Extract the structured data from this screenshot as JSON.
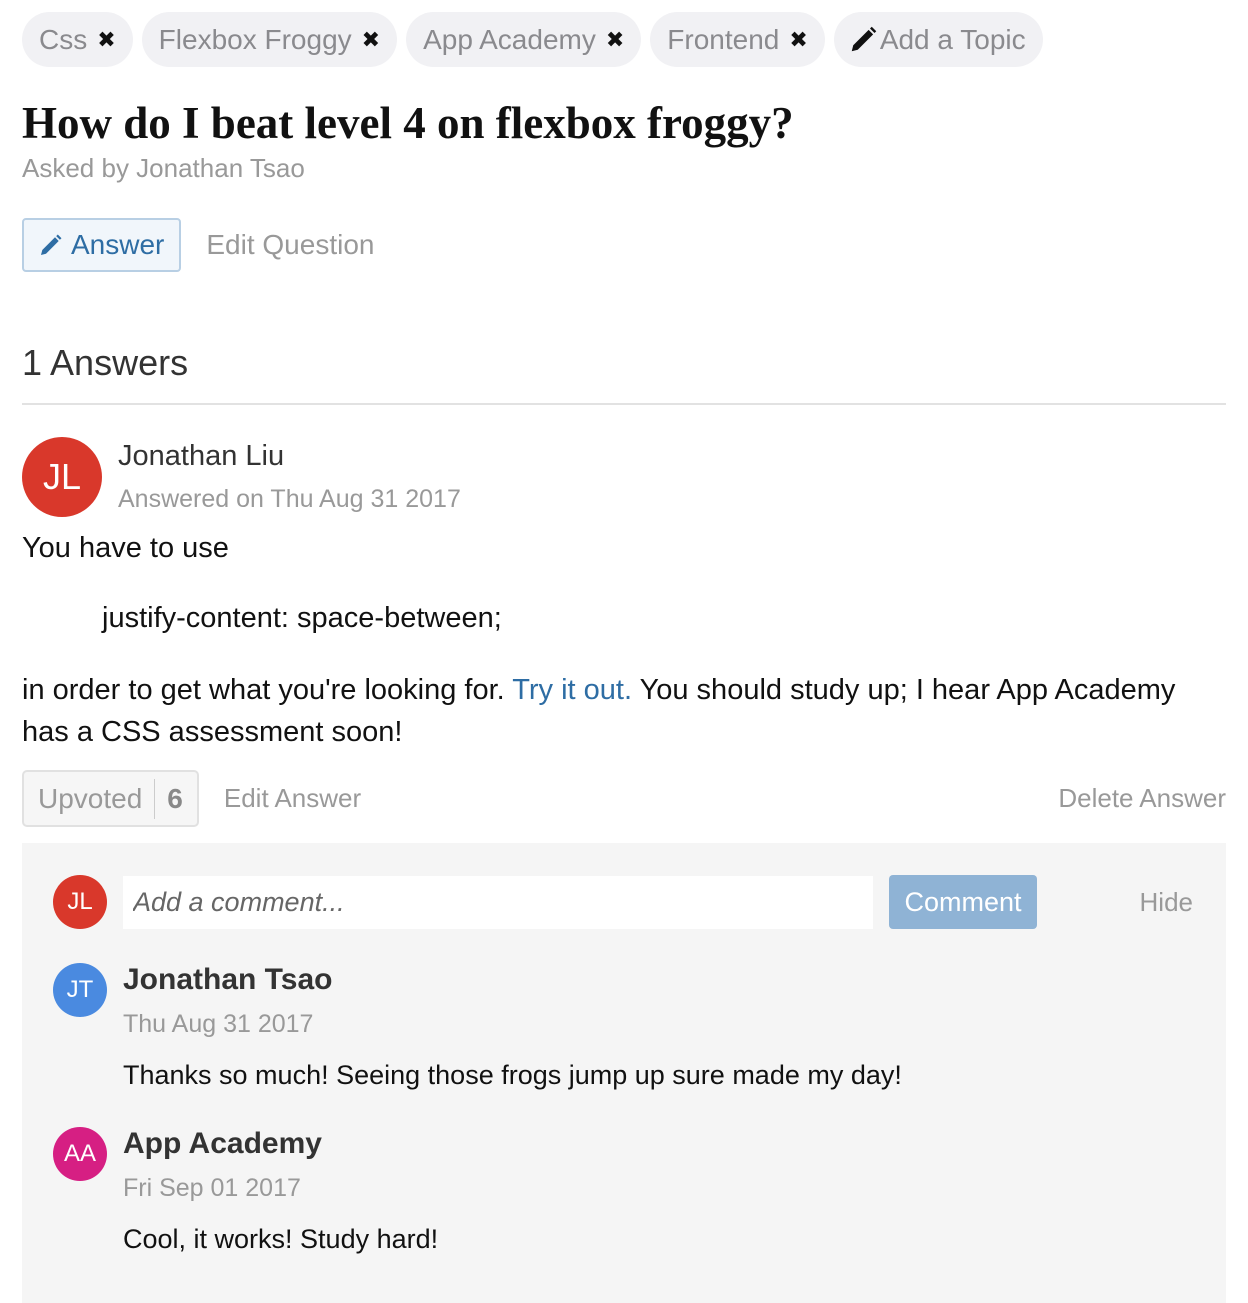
{
  "topics": [
    {
      "label": "Css"
    },
    {
      "label": "Flexbox Froggy"
    },
    {
      "label": "App Academy"
    },
    {
      "label": "Frontend"
    }
  ],
  "topic_remove_glyph": "✖",
  "add_topic_label": "Add a Topic",
  "question": {
    "title": "How do I beat level 4 on flexbox froggy?",
    "asked_by": "Asked by Jonathan Tsao",
    "answer_button": "Answer",
    "edit_button": "Edit Question"
  },
  "answers_heading": "1 Answers",
  "answer": {
    "avatar_initials": "JL",
    "avatar_color": "#d9382b",
    "author": "Jonathan Liu",
    "answered_on": "Answered on Thu Aug 31 2017",
    "text_intro": "You have to use",
    "code_line": "justify-content: space-between;",
    "text_before_link": "in order to get what you're looking for. ",
    "link_text": "Try it out.",
    "text_after_link": " You should study up; I hear App Academy has a CSS assessment soon!",
    "upvote_label": "Upvoted",
    "upvote_count": "6",
    "edit_label": "Edit Answer",
    "delete_label": "Delete Answer"
  },
  "comment_box": {
    "avatar_initials": "JL",
    "avatar_color": "#d9382b",
    "placeholder": "Add a comment...",
    "submit_label": "Comment",
    "hide_label": "Hide"
  },
  "comments": [
    {
      "initials": "JT",
      "color": "#4a8ae0",
      "author": "Jonathan Tsao",
      "date": "Thu Aug 31 2017",
      "text": "Thanks so much! Seeing those frogs jump up sure made my day!"
    },
    {
      "initials": "AA",
      "color": "#d61f83",
      "author": "App Academy",
      "date": "Fri Sep 01 2017",
      "text": "Cool, it works! Study hard!"
    }
  ]
}
